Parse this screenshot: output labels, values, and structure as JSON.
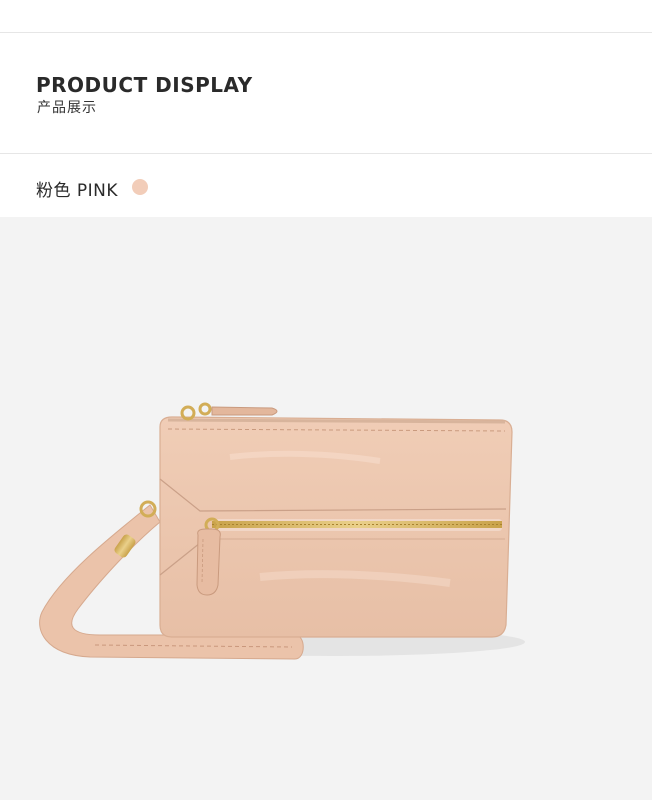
{
  "header": {
    "title_en": "PRODUCT DISPLAY",
    "title_zh": "产品展示"
  },
  "color_option": {
    "label": "粉色 PINK",
    "swatch_color": "#f2cdb9"
  },
  "product_photo": {
    "icon": "pink-wristlet-wallet",
    "leather_color": "#ecc5ad",
    "hardware_color": "#d6b25e",
    "background_color": "#f3f3f3"
  }
}
